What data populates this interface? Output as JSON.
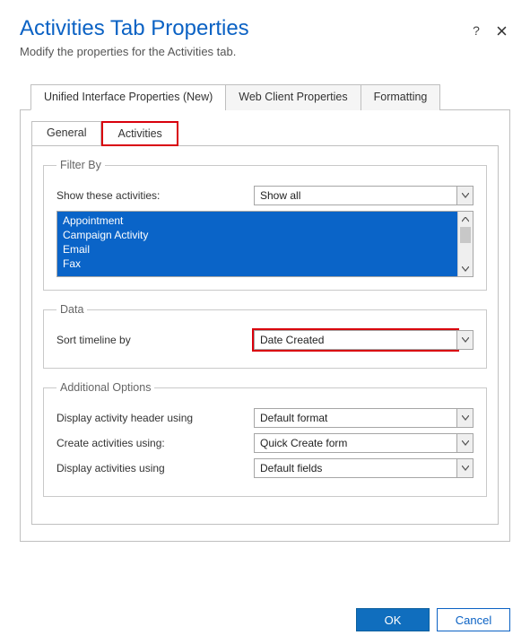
{
  "header": {
    "title": "Activities Tab Properties",
    "subtitle": "Modify the properties for the Activities tab."
  },
  "tabs": {
    "items": [
      {
        "label": "Unified Interface Properties (New)",
        "active": true
      },
      {
        "label": "Web Client Properties",
        "active": false
      },
      {
        "label": "Formatting",
        "active": false
      }
    ]
  },
  "subtabs": {
    "items": [
      {
        "label": "General",
        "active": false
      },
      {
        "label": "Activities",
        "active": true
      }
    ]
  },
  "filterBy": {
    "legend": "Filter By",
    "showLabel": "Show these activities:",
    "showValue": "Show all",
    "listItems": [
      "Appointment",
      "Campaign Activity",
      "Email",
      "Fax"
    ]
  },
  "data": {
    "legend": "Data",
    "sortLabel": "Sort timeline by",
    "sortValue": "Date Created"
  },
  "additional": {
    "legend": "Additional Options",
    "rows": [
      {
        "label": "Display activity header using",
        "value": "Default format"
      },
      {
        "label": "Create activities using:",
        "value": "Quick Create form"
      },
      {
        "label": "Display activities using",
        "value": "Default fields"
      }
    ]
  },
  "footer": {
    "ok": "OK",
    "cancel": "Cancel"
  }
}
